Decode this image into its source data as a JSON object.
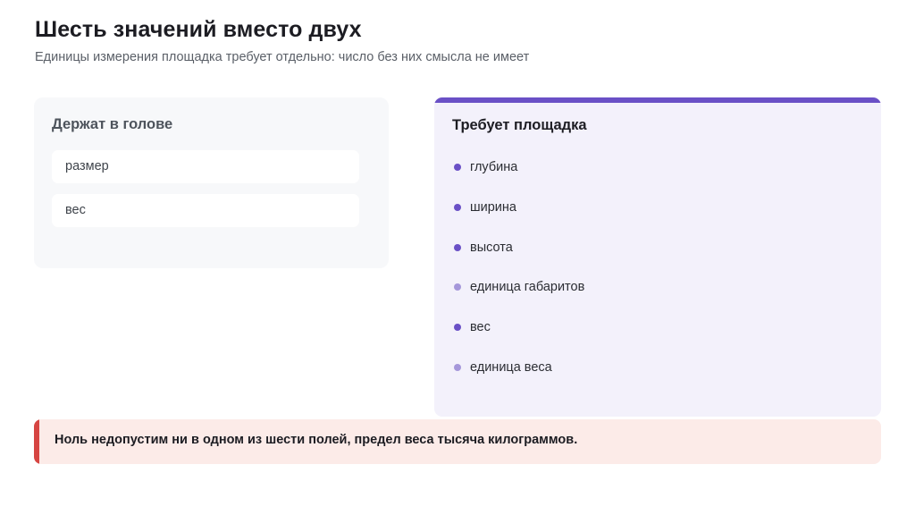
{
  "header": {
    "title": "Шесть значений вместо двух",
    "subtitle": "Единицы измерения площадка требует отдельно: число без них смысла не имеет"
  },
  "left_card": {
    "title": "Держат в голове",
    "items": [
      "размер",
      "вес"
    ]
  },
  "right_card": {
    "title": "Требует площадка",
    "accent_color": "#6a50c6",
    "items": [
      {
        "label": "глубина",
        "dot": "dark"
      },
      {
        "label": "ширина",
        "dot": "dark"
      },
      {
        "label": "высота",
        "dot": "dark"
      },
      {
        "label": "единица габаритов",
        "dot": "light"
      },
      {
        "label": "вес",
        "dot": "dark"
      },
      {
        "label": "единица веса",
        "dot": "light"
      }
    ]
  },
  "note": {
    "text": "Ноль недопустим ни в одном из шести полей, предел веса тысяча килограммов.",
    "accent_color": "#d64542"
  }
}
